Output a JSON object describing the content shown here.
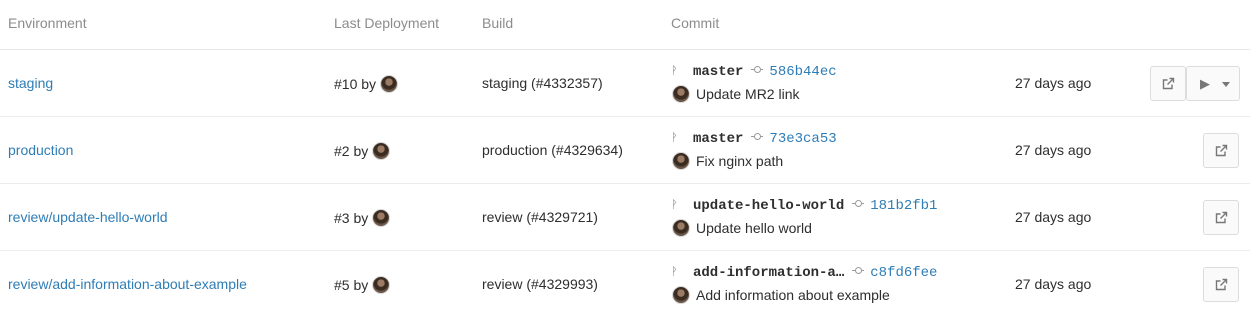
{
  "headers": {
    "environment": "Environment",
    "last_deployment": "Last Deployment",
    "build": "Build",
    "commit": "Commit"
  },
  "icons": {
    "branch": "branch-icon",
    "commit": "commit-icon",
    "external": "external-link-icon",
    "play": "play-icon",
    "caret": "caret-down-icon"
  },
  "colors": {
    "link": "#2e7db6",
    "muted": "#8c8c8c"
  },
  "rows": [
    {
      "environment": "staging",
      "deployment": "#10 by",
      "build": "staging (#4332357)",
      "ref": "master",
      "sha": "586b44ec",
      "message": "Update MR2 link",
      "ago": "27 days ago"
    },
    {
      "environment": "production",
      "deployment": "#2 by",
      "build": "production (#4329634)",
      "ref": "master",
      "sha": "73e3ca53",
      "message": "Fix nginx path",
      "ago": "27 days ago"
    },
    {
      "environment": "review/update-hello-world",
      "deployment": "#3 by",
      "build": "review (#4329721)",
      "ref": "update-hello-world",
      "sha": "181b2fb1",
      "message": "Update hello world",
      "ago": "27 days ago"
    },
    {
      "environment": "review/add-information-about-example",
      "deployment": "#5 by",
      "build": "review (#4329993)",
      "ref": "add-information-a…",
      "sha": "c8fd6fee",
      "message": "Add information about example",
      "ago": "27 days ago"
    }
  ]
}
